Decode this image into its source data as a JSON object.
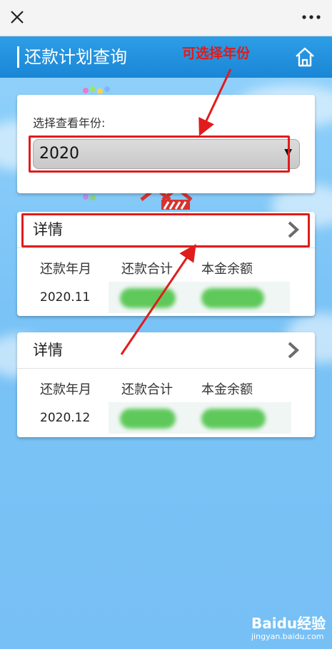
{
  "header": {
    "title": "还款计划查询",
    "annotation": "可选择年份"
  },
  "year_select": {
    "label": "选择查看年份:",
    "value": "2020"
  },
  "records": [
    {
      "title": "详情",
      "columns": [
        "还款年月",
        "还款合计",
        "本金余额"
      ],
      "month": "2020.11"
    },
    {
      "title": "详情",
      "columns": [
        "还款年月",
        "还款合计",
        "本金余额"
      ],
      "month": "2020.12"
    }
  ],
  "watermark": {
    "brand": "Baidu经验",
    "url": "jingyan.baidu.com"
  },
  "colors": {
    "header_blue": "#1a86d6",
    "annotation_red": "#e01c1c",
    "background_blue": "#7cc4f5"
  }
}
